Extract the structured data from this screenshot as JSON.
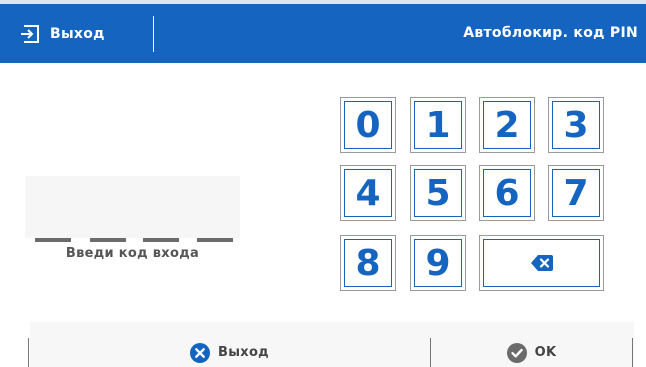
{
  "header": {
    "exit_label": "Выход",
    "title": "Автоблокир. код PIN"
  },
  "pin": {
    "label": "Введи код входа",
    "entered_digits": 0,
    "length": 4
  },
  "keypad": {
    "keys": [
      "0",
      "1",
      "2",
      "3",
      "4",
      "5",
      "6",
      "7",
      "8",
      "9"
    ],
    "backspace_icon": "backspace-icon"
  },
  "footer": {
    "exit_label": "Выход",
    "ok_label": "OK"
  },
  "colors": {
    "accent": "#1565c0",
    "header_text": "#ffffff",
    "key_text": "#1565c0",
    "ok_icon": "#6b6b6b"
  }
}
